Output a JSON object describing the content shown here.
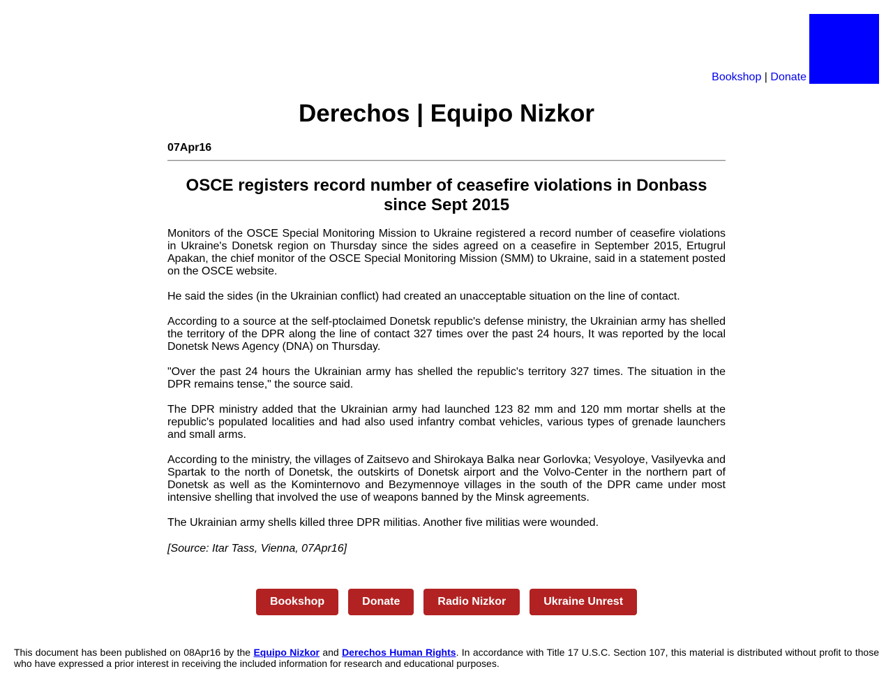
{
  "header": {
    "bookshop_link": "Bookshop",
    "separator": "|",
    "donate_link": "Donate",
    "logo_color": "#0000ff"
  },
  "site_title": "Derechos | Equipo Nizkor",
  "article": {
    "date": "07Apr16",
    "headline": "OSCE registers record number of ceasefire violations in Donbass since Sept 2015",
    "paragraphs": [
      "Monitors of the OSCE Special Monitoring Mission to Ukraine registered a record number of ceasefire violations in Ukraine's Donetsk region on Thursday since the sides agreed on a ceasefire in September 2015, Ertugrul Apakan, the chief monitor of the OSCE Special Monitoring Mission (SMM) to Ukraine, said in a statement posted on the OSCE website.",
      "He said the sides (in the Ukrainian conflict) had created an unacceptable situation on the line of contact.",
      "According to a source at the self-ptoclaimed Donetsk republic's defense ministry, the Ukrainian army has shelled the territory of the DPR along the line of contact 327 times over the past 24 hours, It was reported by the local Donetsk News Agency (DNA) on Thursday.",
      "\"Over the past 24 hours the Ukrainian army has shelled the republic's territory 327 times. The situation in the DPR remains tense,\" the source said.",
      "The DPR ministry added that the Ukrainian army had launched 123 82 mm and 120 mm mortar shells at the republic's populated localities and had also used infantry combat vehicles, various types of grenade launchers and small arms.",
      "According to the ministry, the villages of Zaitsevo and Shirokaya Balka near Gorlovka; Vesyoloye, Vasilyevka and Spartak to the north of Donetsk, the outskirts of Donetsk airport and the Volvo-Center in the northern part of Donetsk as well as the Kominternovo and Bezymennoye villages in the south of the DPR came under most intensive shelling that involved the use of weapons banned by the Minsk agreements.",
      "The Ukrainian army shells killed three DPR militias. Another five militias were wounded."
    ],
    "source": "[Source: Itar Tass, Vienna, 07Apr16]"
  },
  "buttons": [
    "Bookshop",
    "Donate",
    "Radio Nizkor",
    "Ukraine Unrest"
  ],
  "button_color": "#b22222",
  "footer": {
    "text_before": "This document has been published on 08Apr16 by the ",
    "link1": "Equipo Nizkor",
    "text_and": " and ",
    "link2": "Derechos Human Rights",
    "text_after": ". In accordance with Title 17 U.S.C. Section 107, this material is distributed without profit to those who have expressed a prior interest in receiving the included information for research and educational purposes."
  }
}
